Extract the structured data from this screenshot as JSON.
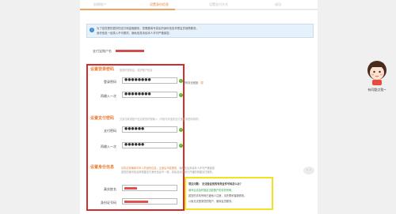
{
  "steps": [
    "创建账户",
    "设置身份信息",
    "设置支付方式",
    "成功"
  ],
  "active_step": 1,
  "notice": {
    "line1": "为了给您提供更好的支付和金融服务，您需要填写真实的身份信息享受会员保障服务。",
    "line2": "身份信息一经录入不可更改，隐私信息未经本人许可严格保密。"
  },
  "account": {
    "label": "支付宝账户名"
  },
  "login_password": {
    "title": "设置登录密码",
    "hint": "登录时需验证，保护账户信息",
    "label": "登录密码",
    "value": "●●●●●●●●",
    "confirm_label": "再输入一次",
    "confirm_value": "●●●●●●●●",
    "strength_label": "密码安全程度：",
    "strength_value": "弱"
  },
  "pay_password": {
    "title": "设置支付密码",
    "hint": "交易付款或账户信息更改时需输入（不能与淘宝或支付宝登录密码相同）",
    "label": "支付密码",
    "value": "●●●●●●",
    "confirm_label": "再输入一次",
    "confirm_value": "●●●●●●"
  },
  "identity": {
    "title": "设置身份信息",
    "hint_prefix": "请务必准确填写本人的身份信息，注册后不能更改，",
    "hint_rest": "隐私信息未经本人许可严格保密",
    "hint_line2": "若您的身份信息和快捷支付身份信息不一致，将会自动关闭已开通的快捷支付服务。",
    "name_label": "真实姓名",
    "id_label": "身份证号码"
  },
  "tips": {
    "title": "常见问题：  无法验证到的有效证件号码怎么办？",
    "line1": "填写后请及时验证当前账户的手机号码，",
    "line2": "若您的手机号码已被他人注册，请先联系客服修改。",
    "line3": "以免无法登录您的账户，使用会员服务。"
  },
  "helper": {
    "label": "有问题点我~"
  },
  "colors": {
    "accent": "#e8823a",
    "highlight_red": "#d42b2b",
    "highlight_yellow": "#f3e21f",
    "success": "#5cb531"
  }
}
